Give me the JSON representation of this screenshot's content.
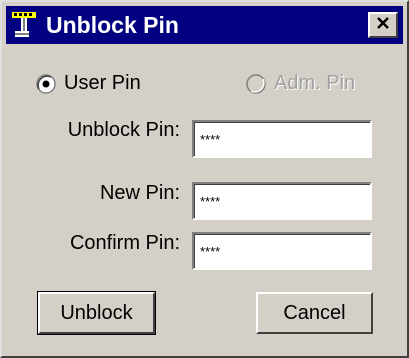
{
  "window": {
    "title": "Unblock Pin",
    "titlebar_color": "#000080",
    "icon": "pin-icon",
    "close_icon": "close-icon"
  },
  "pin_type": {
    "options": [
      {
        "label": "User Pin",
        "selected": true,
        "enabled": true
      },
      {
        "label": "Adm. Pin",
        "selected": false,
        "enabled": false
      }
    ]
  },
  "fields": {
    "unblock_pin": {
      "label": "Unblock Pin:",
      "value": "****"
    },
    "new_pin": {
      "label": "New Pin:",
      "value": "****"
    },
    "confirm_pin": {
      "label": "Confirm Pin:",
      "value": "****"
    }
  },
  "buttons": {
    "unblock": "Unblock",
    "cancel": "Cancel"
  }
}
